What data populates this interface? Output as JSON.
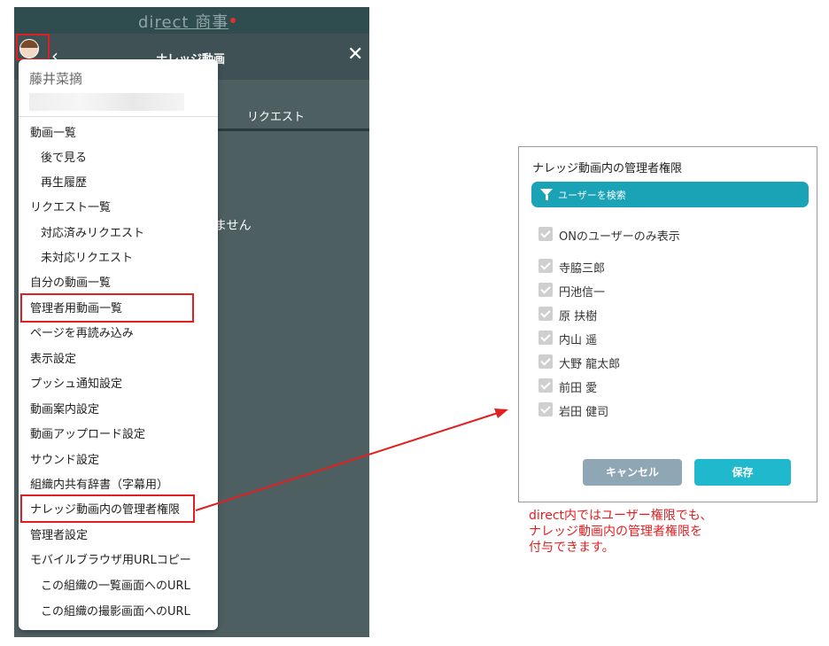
{
  "app": {
    "name_part1": "di",
    "name_part2": "rect 商事",
    "header_title": "ナレッジ動画",
    "back_icon": "chevron-left-icon",
    "close_icon": "close-icon",
    "tab_request": "リクエスト",
    "empty_text": "ません"
  },
  "menu": {
    "user_name": "藤井菜摘",
    "items": [
      "動画一覧",
      "後で見る",
      "再生履歴",
      "リクエスト一覧",
      "対応済みリクエスト",
      "未対応リクエスト",
      "自分の動画一覧",
      "管理者用動画一覧",
      "ページを再読み込み",
      "表示設定",
      "プッシュ通知設定",
      "動画案内設定",
      "動画アップロード設定",
      "サウンド設定",
      "組織内共有辞書（字幕用）",
      "ナレッジ動画内の管理者権限",
      "管理者設定",
      "モバイルブラウザ用URLコピー",
      "この組織の一覧画面へのURL",
      "この組織の撮影画面へのURL"
    ]
  },
  "dialog": {
    "title": "ナレッジ動画内の管理者権限",
    "search_label": "ユーザーを検索",
    "only_on_label": "ONのユーザーのみ表示",
    "users": [
      "寺脇三郎",
      "円池信一",
      "原 扶樹",
      "内山 遥",
      "大野 龍太郎",
      "前田 愛",
      "岩田 健司"
    ],
    "cancel_label": "キャンセル",
    "save_label": "保存"
  },
  "annotation": {
    "line1": "direct内ではユーザー権限でも、",
    "line2": "ナレッジ動画内の管理者権限を",
    "line3": "付与できます。"
  },
  "colors": {
    "accent": "#1aa3b6",
    "highlight": "#e02020"
  }
}
